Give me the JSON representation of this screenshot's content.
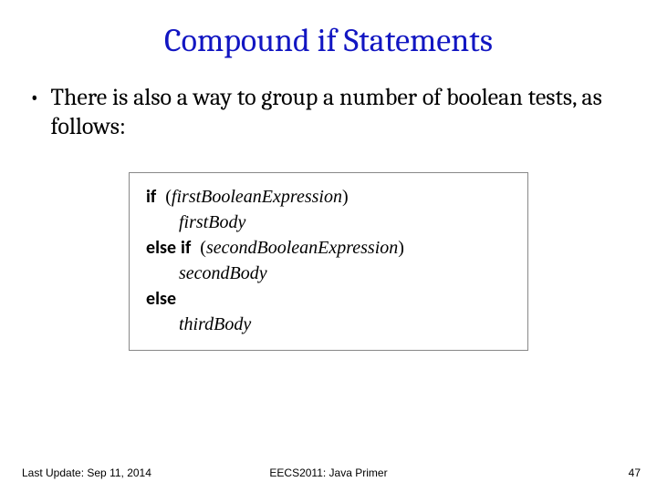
{
  "title": "Compound if Statements",
  "bullet": "There is also a way to group a number of boolean tests, as follows:",
  "code": {
    "kw_if": "if",
    "kw_else": "else",
    "kw_elseif_if": "if",
    "expr1": "firstBooleanExpression",
    "body1": "firstBody",
    "expr2": "secondBooleanExpression",
    "body2": "secondBody",
    "body3": "thirdBody",
    "lparen": "(",
    "rparen": ")"
  },
  "footer": {
    "left": "Last Update: Sep 11, 2014",
    "center": "EECS2011: Java Primer",
    "right": "47"
  }
}
